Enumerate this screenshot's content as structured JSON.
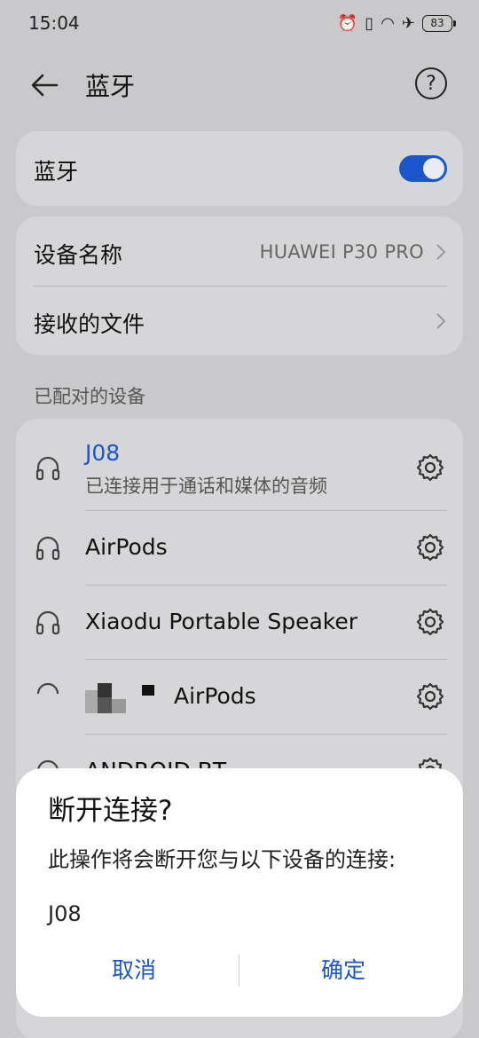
{
  "status_bar": {
    "time": "15:04",
    "battery": "83",
    "icons": [
      "alarm-icon",
      "vibrate-icon",
      "wifi-icon",
      "airplane-icon",
      "battery-icon"
    ]
  },
  "app_bar": {
    "title": "蓝牙",
    "back_icon": "back-arrow-icon",
    "help_icon": "help-icon"
  },
  "bluetooth_card": {
    "label": "蓝牙",
    "toggle_on": true,
    "accent": "#1a56c9"
  },
  "info_card": {
    "device_name_label": "设备名称",
    "device_name_value": "HUAWEI P30 PRO",
    "received_files_label": "接收的文件"
  },
  "paired_section_label": "已配对的设备",
  "paired_devices": [
    {
      "name": "J08",
      "status": "已连接用于通话和媒体的音频",
      "connected": true,
      "icon": "headset-icon"
    },
    {
      "name": "AirPods",
      "status": "",
      "connected": false,
      "icon": "headset-icon"
    },
    {
      "name": "Xiaodu Portable Speaker",
      "status": "",
      "connected": false,
      "icon": "headset-icon"
    },
    {
      "name": "AirPods",
      "status": "",
      "connected": false,
      "icon": "headset-icon"
    },
    {
      "name": "ANDROID BT",
      "status": "",
      "connected": false,
      "icon": "headset-icon"
    }
  ],
  "dialog": {
    "title": "断开连接?",
    "message": "此操作将会断开您与以下设备的连接:",
    "device": "J08",
    "cancel_label": "取消",
    "confirm_label": "确定"
  }
}
